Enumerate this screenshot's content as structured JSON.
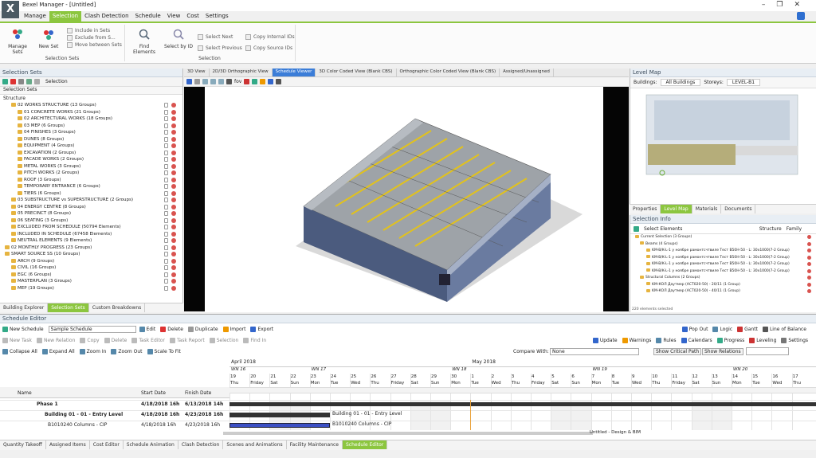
{
  "window": {
    "title": "Bexel Manager - [Untitled]",
    "logo": "X"
  },
  "menu": [
    "Manage",
    "Selection",
    "Clash Detection",
    "Schedule",
    "View",
    "Cost",
    "Settings"
  ],
  "ribbon": {
    "manage_sets": "Manage Sets",
    "new_set": "New Set",
    "include_in_sets": "Include in Sets",
    "exclude_from": "Exclude from S...",
    "move_between": "Move between Sets",
    "group_sets": "Selection Sets",
    "find_elements": "Find Elements",
    "select_by_id": "Select by ID",
    "select_next": "Select Next",
    "select_previous": "Select Previous",
    "copy_internal": "Copy Internal IDs",
    "copy_source": "Copy Source IDs",
    "group_selection": "Selection"
  },
  "left_panel": {
    "header": "Selection Sets",
    "selection_dropdown": "Selection",
    "tab": "Selection Sets",
    "structure": "Structure",
    "tree": [
      {
        "level": 1,
        "text": "02 WORKS STRUCTURE (13 Groups)"
      },
      {
        "level": 2,
        "text": "01 CONCRETE WORKS (21 Groups)"
      },
      {
        "level": 2,
        "text": "02 ARCHITECTURAL WORKS (18 Groups)"
      },
      {
        "level": 2,
        "text": "03 MEP (6 Groups)"
      },
      {
        "level": 2,
        "text": "04 FINISHES (3 Groups)"
      },
      {
        "level": 2,
        "text": "DUNES (8 Groups)"
      },
      {
        "level": 2,
        "text": "EQUIPMENT (4 Groups)"
      },
      {
        "level": 2,
        "text": "EXCAVATION (2 Groups)"
      },
      {
        "level": 2,
        "text": "FACADE WORKS (2 Groups)"
      },
      {
        "level": 2,
        "text": "METAL WORKS (3 Groups)"
      },
      {
        "level": 2,
        "text": "PITCH WORKS (2 Groups)"
      },
      {
        "level": 2,
        "text": "ROOF (3 Groups)"
      },
      {
        "level": 2,
        "text": "TEMPORARY ENTRANCE (6 Groups)"
      },
      {
        "level": 2,
        "text": "TIERS (6 Groups)"
      },
      {
        "level": 1,
        "text": "03 SUBSTRUCTURE vs SUPERSTRUCTURE (2 Groups)"
      },
      {
        "level": 1,
        "text": "04 ENERGY CENTRE (8 Groups)"
      },
      {
        "level": 1,
        "text": "05 PRECINCT (8 Groups)"
      },
      {
        "level": 1,
        "text": "06 SEATING (3 Groups)"
      },
      {
        "level": 1,
        "text": "EXCLUDED FROM SCHEDULE (50794 Elements)"
      },
      {
        "level": 1,
        "text": "INCLUDED IN SCHEDULE (67458 Elements)"
      },
      {
        "level": 1,
        "text": "NEUTRAL ELEMENTS (9 Elements)"
      },
      {
        "level": 0,
        "text": "02 MONTHLY PROGRESS (23 Groups)"
      },
      {
        "level": 0,
        "text": "SMART SOURCE SS (10 Groups)"
      },
      {
        "level": 1,
        "text": "ARCH (9 Groups)"
      },
      {
        "level": 1,
        "text": "CIVIL (16 Groups)"
      },
      {
        "level": 1,
        "text": "EGC (6 Groups)"
      },
      {
        "level": 1,
        "text": "MASTERPLAN (3 Groups)"
      },
      {
        "level": 1,
        "text": "MEP (19 Groups)"
      }
    ],
    "bottom_tabs": [
      "Building Explorer",
      "Selection Sets",
      "Custom Breakdowns"
    ]
  },
  "view_tabs": [
    "3D View",
    "2D/3D Orthographic View",
    "Schedule Viewer",
    "3D Color Coded View (Blank CBS)",
    "Orthographic Color Coded View (Blank CBS)",
    "Assigned/Unassigned"
  ],
  "view_toolbar": {
    "fov": "fov"
  },
  "level_map": {
    "header": "Level Map",
    "buildings_label": "Buildings:",
    "buildings_value": "All Buildings",
    "storeys_label": "Storeys:",
    "storeys_value": "LEVEL-B1"
  },
  "right_tabs": [
    "Properties",
    "Level Map",
    "Materials",
    "Documents"
  ],
  "selection_info": {
    "header": "Selection Info",
    "select_elements": "Select Elements",
    "structure": "Structure",
    "family": "Family",
    "rows": [
      "Current Selection (3 Groups)",
      "Beams (4 Groups)",
      "KM-B/K-L-1 y ноябре рамонтсчтвиле Тест B50Н-50 - L: 30x1000(7-2 Group)",
      "KM-B/K-L-1 y ноябре рамонтсчтвиле Тест B50Н-50 - L: 30x1000(7-2 Group)",
      "KM-B/K-L-1 y ноябре рамонтсчтвиле Тест B50Н-50 - L: 30x1000(7-2 Group)",
      "KM-B/K-L-1 y ноябре рамонтсчтвиле Тест B50Н-50 - L: 30x1000(7-2 Group)",
      "Structural Columns (2 Groups)",
      "KM-КОЛ Даутмер (АСТ020-50) - 20/11 (1 Group)",
      "KM-КОЛ Даутмер (АСТ020-50) - 40/11 (1 Group)"
    ],
    "footer": "220 elements selected"
  },
  "schedule": {
    "header": "Schedule Editor",
    "new_schedule": "New Schedule",
    "schedule_name": "Sample Schedule",
    "edit": "Edit",
    "delete": "Delete",
    "duplicate": "Duplicate",
    "import": "Import",
    "export": "Export",
    "pop_out": "Pop Out",
    "logic": "Logic",
    "gantt": "Gantt",
    "line_of_balance": "Line of Balance",
    "new_task": "New Task",
    "new_relation": "New Relation",
    "copy": "Copy",
    "delete2": "Delete",
    "task_editor": "Task Editor",
    "task_report": "Task Report",
    "selection": "Selection",
    "find_in": "Find In",
    "update": "Update",
    "warnings": "Warnings",
    "rules": "Rules",
    "calendars": "Calendars",
    "progress": "Progress",
    "leveling": "Leveling",
    "settings": "Settings",
    "collapse_all": "Collapse All",
    "expand_all": "Expand All",
    "zoom_in": "Zoom In",
    "zoom_out": "Zoom Out",
    "scale_to_fit": "Scale To Fit",
    "compare_with": "Compare With:",
    "compare_value": "None",
    "critical_path": "Show Critical Path",
    "show_relations": "Show Relations",
    "months": [
      {
        "label": "April 2018",
        "col": 0
      },
      {
        "label": "May 2018",
        "col": 12
      }
    ],
    "weeks": [
      {
        "label": "WN 16",
        "col": 0
      },
      {
        "label": "WN 17",
        "col": 4
      },
      {
        "label": "WN 18",
        "col": 11
      },
      {
        "label": "WN 19",
        "col": 18
      },
      {
        "label": "WN 20",
        "col": 25
      }
    ],
    "days": [
      [
        "19",
        "Thu"
      ],
      [
        "20",
        "Friday"
      ],
      [
        "21",
        "Sat"
      ],
      [
        "22",
        "Sun"
      ],
      [
        "23",
        "Mon"
      ],
      [
        "24",
        "Tue"
      ],
      [
        "25",
        "Wed"
      ],
      [
        "26",
        "Thu"
      ],
      [
        "27",
        "Friday"
      ],
      [
        "28",
        "Sat"
      ],
      [
        "29",
        "Sun"
      ],
      [
        "30",
        "Mon"
      ],
      [
        "1",
        "Tue"
      ],
      [
        "2",
        "Wed"
      ],
      [
        "3",
        "Thu"
      ],
      [
        "4",
        "Friday"
      ],
      [
        "5",
        "Sat"
      ],
      [
        "6",
        "Sun"
      ],
      [
        "7",
        "Mon"
      ],
      [
        "8",
        "Tue"
      ],
      [
        "9",
        "Wed"
      ],
      [
        "10",
        "Thu"
      ],
      [
        "11",
        "Friday"
      ],
      [
        "12",
        "Sat"
      ],
      [
        "13",
        "Sun"
      ],
      [
        "14",
        "Mon"
      ],
      [
        "15",
        "Tue"
      ],
      [
        "16",
        "Wed"
      ],
      [
        "17",
        "Thu"
      ]
    ],
    "columns": {
      "name": "Name",
      "start": "Start Date",
      "finish": "Finish Date"
    },
    "rows": [
      {
        "name": "Phase 1",
        "start": "4/18/2018 16h",
        "finish": "6/13/2018 14h",
        "bold": true,
        "bar_label": ""
      },
      {
        "name": "Building 01 - 01 - Entry Level",
        "start": "4/18/2018 16h",
        "finish": "4/23/2018 16h",
        "bold": true,
        "bar_label": "Building 01 - 01 - Entry Level"
      },
      {
        "name": "B1010240 Columns - CIP",
        "start": "4/18/2018 16h",
        "finish": "4/23/2018 16h",
        "bold": false,
        "bar_label": "B1010240 Columns - CIP"
      }
    ],
    "footer_right": "Untitled  - Design & BIM"
  },
  "bottom_tabs": [
    "Quantity Takeoff",
    "Assigned Items",
    "Cost Editor",
    "Schedule Animation",
    "Clash Detection",
    "Scenes and Animations",
    "Facility Maintenance",
    "Schedule Editor"
  ]
}
